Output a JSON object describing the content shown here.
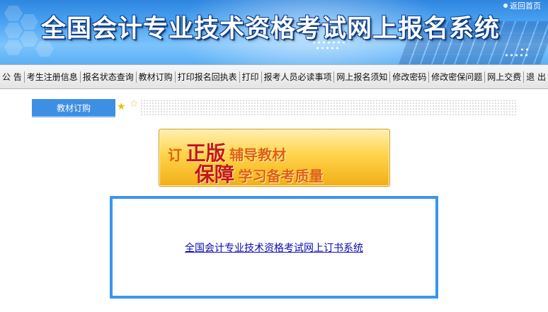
{
  "header": {
    "title": "全国会计专业技术资格考试网上报名系统",
    "home_link": "返回首页"
  },
  "nav": {
    "items": [
      "公 告",
      "考生注册信息",
      "报名状态查询",
      "教材订购",
      "打印报名回执表",
      "打印",
      "报考人员必读事项",
      "网上报名须知",
      "修改密码",
      "修改密保问题",
      "网上交费",
      "退 出"
    ]
  },
  "tab": {
    "label": "教材订购"
  },
  "promo": {
    "line1_prefix": "订",
    "line1_big": "正版",
    "line1_rest": "辅导教材",
    "line2_big": "保障",
    "line2_rest": "学习备考质量"
  },
  "order_link": {
    "label": "全国会计专业技术资格考试网上订书系统"
  },
  "colors": {
    "banner_blue": "#3d8fe3",
    "link_box_border": "#3a95ee",
    "link_color": "#0a0ab3"
  }
}
